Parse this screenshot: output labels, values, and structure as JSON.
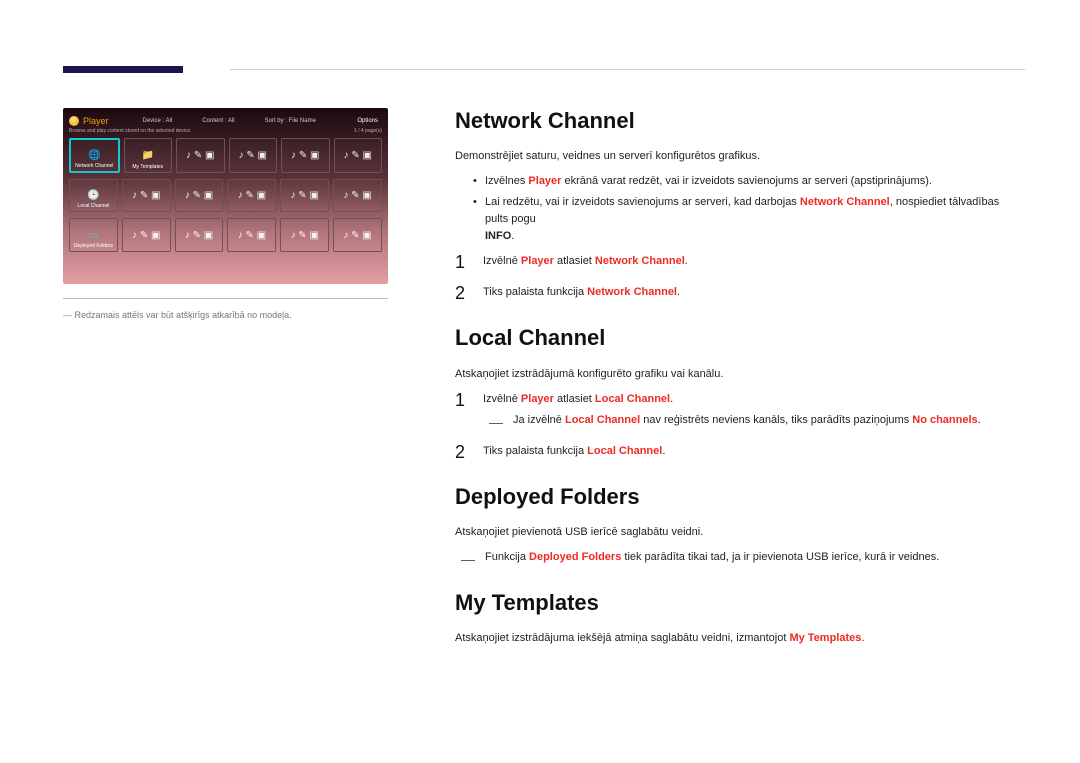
{
  "header": {
    "accent": "#1b1652"
  },
  "screenshot": {
    "title": "Player",
    "menu": {
      "device": "Device : All",
      "content": "Content : All",
      "sort": "Sort by : File Name",
      "options": "Options"
    },
    "sub": {
      "left": "Browse and play content stored on the selected device.",
      "right": "1 / 4 page(s)"
    },
    "row1": [
      {
        "label": "Network Channel",
        "selected": true
      },
      {
        "label": "My Templates"
      },
      {
        "label": ""
      },
      {
        "label": ""
      },
      {
        "label": ""
      },
      {
        "label": ""
      }
    ],
    "row2_label": "Local Channel",
    "row3_label": "Deployed Folders"
  },
  "caption": "Redzamais attēls var būt atšķirīgs atkarībā no modeļa.",
  "sections": {
    "network": {
      "title": "Network Channel",
      "intro": "Demonstrējiet saturu, veidnes un serverī konfigurētos grafikus.",
      "b1_a": "Izvēlnes ",
      "b1_b": " ekrānā varat redzēt, vai ir izveidots savienojums ar serveri (apstiprinājums).",
      "b2_a": "Lai redzētu, vai ir izveidots savienojums ar serveri, kad darbojas ",
      "b2_b": ", nospiediet tālvadības pults pogu ",
      "s1_a": "Izvēlnē ",
      "s1_b": " atlasiet ",
      "s2_a": "Tiks palaista funkcija ",
      "player": "Player",
      "nc": "Network Channel",
      "info": "INFO"
    },
    "local": {
      "title": "Local Channel",
      "intro": "Atskaņojiet izstrādājumā konfigurēto grafiku vai kanālu.",
      "s1_a": "Izvēlnē ",
      "s1_b": " atlasiet ",
      "note_a": "Ja izvēlnē ",
      "note_b": " nav reģistrēts neviens kanāls, tiks parādīts paziņojums ",
      "s2_a": "Tiks palaista funkcija ",
      "player": "Player",
      "lc": "Local Channel",
      "nochan": "No channels"
    },
    "deployed": {
      "title": "Deployed Folders",
      "intro": "Atskaņojiet pievienotā USB ierīcē saglabātu veidni.",
      "note_a": "Funkcija ",
      "note_b": " tiek parādīta tikai tad, ja ir pievienota USB ierīce, kurā ir veidnes.",
      "df": "Deployed Folders"
    },
    "templates": {
      "title": "My Templates",
      "intro_a": "Atskaņojiet izstrādājuma iekšējā atmiņa saglabātu veidni, izmantojot ",
      "mt": "My Templates"
    }
  }
}
